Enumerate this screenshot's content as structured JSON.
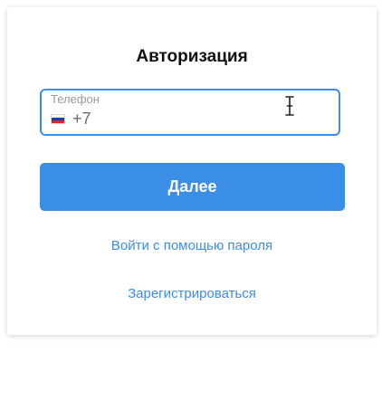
{
  "form": {
    "title": "Авторизация",
    "phone": {
      "label": "Телефон",
      "value": "+7",
      "country_flag_icon": "russia-flag-icon"
    },
    "next_button_label": "Далее",
    "password_login_link": "Войти с помощью пароля",
    "register_link": "Зарегистрироваться"
  },
  "colors": {
    "accent": "#3a8ee6",
    "title_text": "#111111",
    "label_text": "#9a9a9a"
  }
}
